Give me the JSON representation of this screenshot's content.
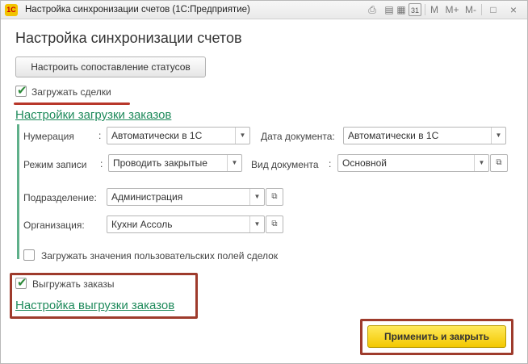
{
  "window": {
    "title": "Настройка синхронизации счетов  (1С:Предприятие)",
    "logo": "1С",
    "toolbar": {
      "m": "M",
      "mplus": "M+",
      "mminus": "M-",
      "calendar_day": "31"
    }
  },
  "form": {
    "heading": "Настройка синхронизации счетов",
    "configure_statuses_button": "Настроить сопоставление статусов",
    "load_deals": {
      "label": "Загружать сделки",
      "checked": true
    },
    "load_settings_link": "Настройки загрузки заказов",
    "numbering": {
      "label": "Нумерация",
      "value": "Автоматически в 1С"
    },
    "document_date": {
      "label": "Дата документа:",
      "value": "Автоматически в 1С"
    },
    "write_mode": {
      "label": "Режим записи",
      "value": "Проводить закрытые"
    },
    "document_type": {
      "label": "Вид документа",
      "value": "Основной"
    },
    "department": {
      "label": "Подразделение:",
      "value": "Администрация"
    },
    "organization": {
      "label": "Организация:",
      "value": "Кухни Ассоль"
    },
    "load_custom_fields": {
      "label": "Загружать значения пользовательских полей сделок",
      "checked": false
    },
    "export_orders": {
      "label": "Выгружать заказы",
      "checked": true
    },
    "export_settings_link": "Настройка выгрузки заказов",
    "apply_close_button": "Применить и закрыть"
  },
  "colors": {
    "accent_green": "#1e8a5b",
    "highlight_red": "#9e3b2c",
    "primary_button": "#f3c800"
  }
}
